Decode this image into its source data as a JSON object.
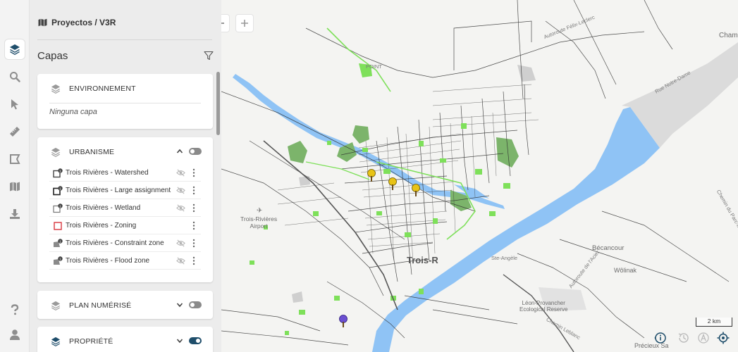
{
  "breadcrumb": {
    "text": "Proyectos / V3R"
  },
  "panel": {
    "title": "Capas"
  },
  "rail": {
    "items": [
      {
        "icon": "layers-icon"
      },
      {
        "icon": "search-icon"
      },
      {
        "icon": "pointer-icon"
      },
      {
        "icon": "ruler-icon"
      },
      {
        "icon": "draw-polygon-icon"
      },
      {
        "icon": "map-icon"
      },
      {
        "icon": "download-icon"
      },
      {
        "icon": "help-icon"
      },
      {
        "icon": "user-icon"
      }
    ]
  },
  "groups": [
    {
      "name": "ENVIRONNEMENT",
      "empty_text": "Ninguna capa",
      "toggle": null
    },
    {
      "name": "URBANISME",
      "expanded": true,
      "toggle": "off",
      "layers": [
        {
          "name": "Trois Rivières - Watershed",
          "badge": "1",
          "visible_icon": true
        },
        {
          "name": "Trois Rivières - Large assignment",
          "badge": "1",
          "visible_icon": true
        },
        {
          "name": "Trois Rivières - Wetland",
          "badge": "1",
          "visible_icon": true
        },
        {
          "name": "Trois Rivières - Zoning",
          "badge": "",
          "visible_icon": false
        },
        {
          "name": "Trois Rivières - Constraint zone",
          "badge": "1",
          "visible_icon": true
        },
        {
          "name": "Trois Rivières - Flood zone",
          "badge": "1",
          "visible_icon": true
        }
      ]
    },
    {
      "name": "PLAN NUMÉRISÉ",
      "expanded": false,
      "toggle": "off"
    },
    {
      "name": "PROPRIÉTÉ",
      "expanded": false,
      "toggle": "on"
    }
  ],
  "map": {
    "labels": {
      "autoroute_felix": "Autoroute Félix-Leclerc",
      "rue_notre_dame": "Rue Notre-Dame",
      "cham": "Cham",
      "point": "POINT",
      "airport": "Trois-Rivières\nAirport",
      "trois": "Trois-R",
      "ste_angele": "Ste-Angèle",
      "autoroute_acier": "Autoroute de l'Acier",
      "becancour": "Bécancour",
      "wolinak": "Wôlinak",
      "leon": "Léon-Provancher\nEcological Reserve",
      "chemin_leblanc": "Chemin Leblanc",
      "precieux": "Précieux Sa",
      "chemin_parc": "Chemin du Parc-Indus",
      "autoroute_lr": "Autoroute de l'A"
    },
    "scale_text": "2 km",
    "colors": {
      "water": "#8fc3f5",
      "park": "#7cb46b",
      "green": "#7ee05a",
      "road": "#2f2f2f",
      "land": "#f4f4f2"
    }
  }
}
